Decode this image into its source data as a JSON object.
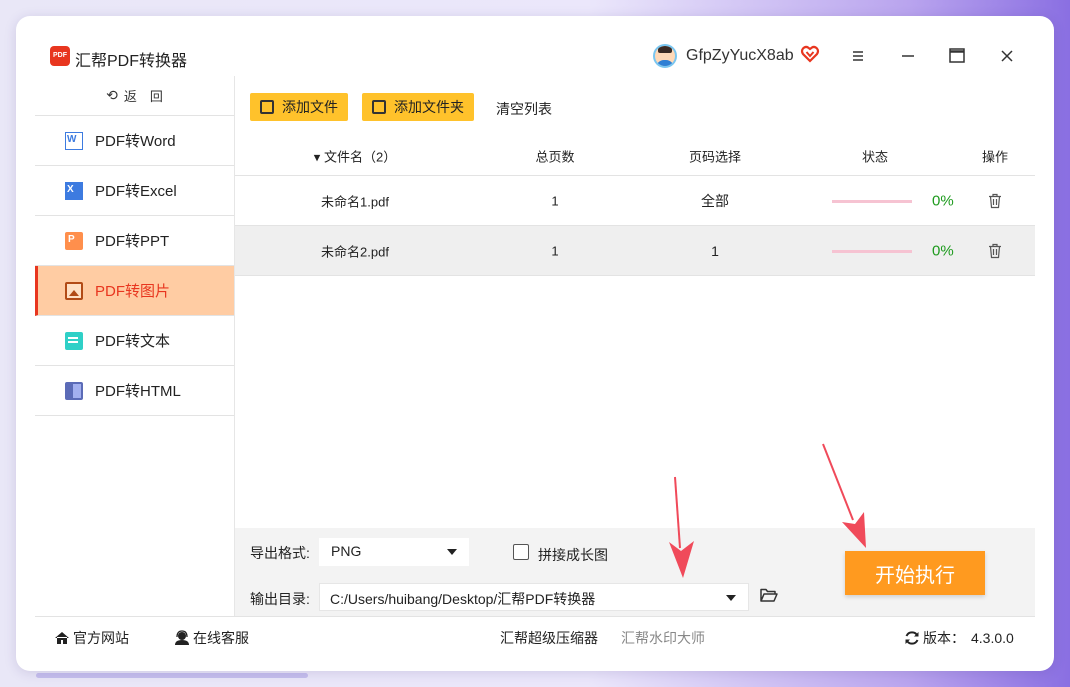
{
  "app": {
    "title": "汇帮PDF转换器",
    "logo_text": "PDF",
    "username": "GfpZyYucX8ab"
  },
  "sidebar": {
    "back_label": "返　回",
    "items": [
      {
        "label": "PDF转Word",
        "icon": "word-icon"
      },
      {
        "label": "PDF转Excel",
        "icon": "excel-icon"
      },
      {
        "label": "PDF转PPT",
        "icon": "ppt-icon"
      },
      {
        "label": "PDF转图片",
        "icon": "image-icon",
        "active": true
      },
      {
        "label": "PDF转文本",
        "icon": "text-icon"
      },
      {
        "label": "PDF转HTML",
        "icon": "html-icon"
      }
    ]
  },
  "toolbar": {
    "add_file": "添加文件",
    "add_folder": "添加文件夹",
    "clear_list": "清空列表"
  },
  "table": {
    "headers": {
      "name": "文件名（2）",
      "pages": "总页数",
      "range": "页码选择",
      "status": "状态",
      "op": "操作"
    },
    "rows": [
      {
        "name": "未命名1.pdf",
        "pages": "1",
        "range": "全部",
        "progress": "0%"
      },
      {
        "name": "未命名2.pdf",
        "pages": "1",
        "range": "1",
        "progress": "0%"
      }
    ]
  },
  "bottom": {
    "format_label": "导出格式:",
    "format_value": "PNG",
    "merge_label": "拼接成长图",
    "merge_checked": false,
    "dir_label": "输出目录:",
    "dir_value": "C:/Users/huibang/Desktop/汇帮PDF转换器",
    "start_label": "开始执行"
  },
  "footer": {
    "website": "官方网站",
    "support": "在线客服",
    "link1": "汇帮超级压缩器",
    "link2": "汇帮水印大师",
    "version_label": "版本：",
    "version": "4.3.0.0"
  },
  "colors": {
    "accent": "#ffc22b",
    "active_bg": "#ffcca3",
    "active_text": "#e8361f",
    "start": "#ff9a1f",
    "progress": "#1d9a1d",
    "arrow": "#f04a5a"
  }
}
